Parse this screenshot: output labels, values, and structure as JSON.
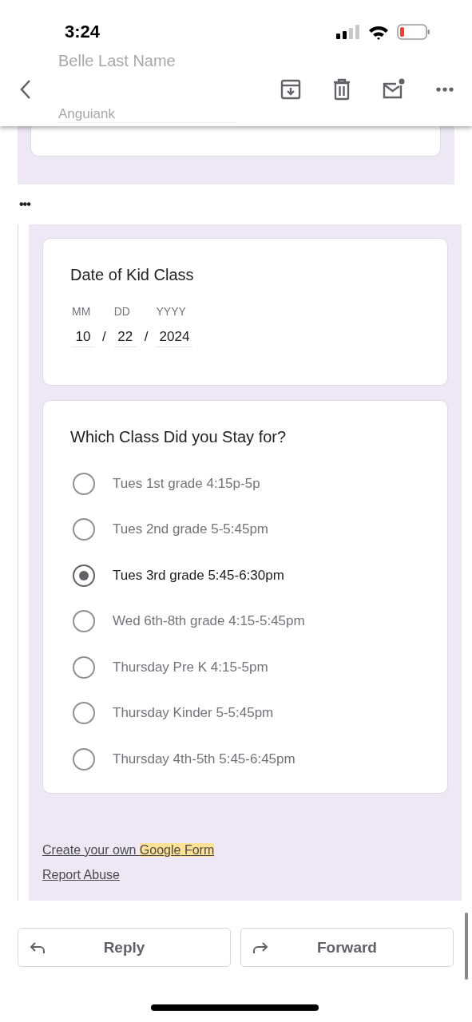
{
  "status_bar": {
    "time": "3:24"
  },
  "header_behind": {
    "name_field": "Belle Last Name",
    "name_value": "Anguiank"
  },
  "collapsed_marker": "•••",
  "form": {
    "date_question": {
      "title": "Date of Kid Class",
      "parts": [
        {
          "label": "MM",
          "value": "10"
        },
        {
          "label": "DD",
          "value": "22"
        },
        {
          "label": "YYYY",
          "value": "2024"
        }
      ],
      "separator": "/"
    },
    "choice_question": {
      "title": "Which Class Did you Stay for?",
      "options": [
        {
          "label": "Tues 1st grade 4:15p-5p",
          "selected": false
        },
        {
          "label": "Tues 2nd grade 5-5:45pm",
          "selected": false
        },
        {
          "label": "Tues 3rd grade 5:45-6:30pm",
          "selected": true
        },
        {
          "label": "Wed 6th-8th grade 4:15-5:45pm",
          "selected": false
        },
        {
          "label": "Thursday Pre K 4:15-5pm",
          "selected": false
        },
        {
          "label": "Thursday Kinder 5-5:45pm",
          "selected": false
        },
        {
          "label": "Thursday 4th-5th 5:45-6:45pm",
          "selected": false
        }
      ]
    },
    "links": [
      {
        "parts": [
          {
            "text": "Create your own ",
            "highlighted": false
          },
          {
            "text": "Google",
            "highlighted": true
          },
          {
            "text": " Form",
            "highlighted": true
          }
        ]
      },
      {
        "parts": [
          {
            "text": "Report Abuse",
            "highlighted": false
          }
        ]
      }
    ]
  },
  "actions": [
    {
      "kind": "reply",
      "label": "Reply"
    },
    {
      "kind": "forward",
      "label": "Forward"
    }
  ]
}
